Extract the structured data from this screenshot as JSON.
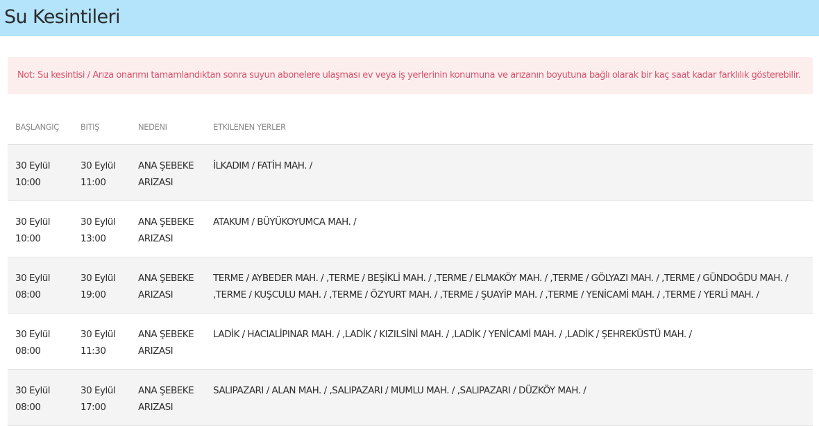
{
  "header": {
    "title": "Su Kesintileri"
  },
  "note": {
    "text": "Not: Su kesintisi / Arıza onarımı tamamlandıktan sonra suyun abonelere ulaşması ev veya iş yerlerinin konumuna ve arızanın boyutuna bağlı olarak bir kaç saat kadar farklılık gösterebilir."
  },
  "colors": {
    "header_bg": "#b3e4fb",
    "note_bg": "#fdeeee",
    "note_text": "#d9536b"
  },
  "table": {
    "columns": [
      "BAŞLANGIÇ",
      "BITIŞ",
      "NEDENI",
      "ETKILENEN YERLER"
    ],
    "rows": [
      {
        "start": [
          "30 Eylül",
          "10:00"
        ],
        "end": [
          "30 Eylül",
          "11:00"
        ],
        "reason": [
          "ANA ŞEBEKE",
          "ARIZASI"
        ],
        "places": "İLKADIM / FATİH MAH. /"
      },
      {
        "start": [
          "30 Eylül",
          "10:00"
        ],
        "end": [
          "30 Eylül",
          "13:00"
        ],
        "reason": [
          "ANA ŞEBEKE",
          "ARIZASI"
        ],
        "places": "ATAKUM / BÜYÜKOYUMCA MAH. /"
      },
      {
        "start": [
          "30 Eylül",
          "08:00"
        ],
        "end": [
          "30 Eylül",
          "19:00"
        ],
        "reason": [
          "ANA ŞEBEKE",
          "ARIZASI"
        ],
        "places": "TERME / AYBEDER MAH. / ,TERME / BEŞİKLİ MAH. / ,TERME / ELMAKÖY MAH. / ,TERME / GÖLYAZI MAH. / ,TERME / GÜNDOĞDU MAH. / ,TERME / KUŞCULU MAH. / ,TERME / ÖZYURT MAH. / ,TERME / ŞUAYİP MAH. / ,TERME / YENİCAMİ MAH. / ,TERME / YERLİ MAH. /"
      },
      {
        "start": [
          "30 Eylül",
          "08:00"
        ],
        "end": [
          "30 Eylül",
          "11:30"
        ],
        "reason": [
          "ANA ŞEBEKE",
          "ARIZASI"
        ],
        "places": "LADİK / HACIALİPINAR MAH. / ,LADİK / KIZILSİNİ MAH. / ,LADİK / YENİCAMİ MAH. / ,LADİK / ŞEHREKÜSTÜ MAH. /"
      },
      {
        "start": [
          "30 Eylül",
          "08:00"
        ],
        "end": [
          "30 Eylül",
          "17:00"
        ],
        "reason": [
          "ANA ŞEBEKE",
          "ARIZASI"
        ],
        "places": "SALIPAZARI / ALAN MAH. / ,SALIPAZARI / MUMLU MAH. / ,SALIPAZARI / DÜZKÖY MAH. /"
      }
    ]
  }
}
